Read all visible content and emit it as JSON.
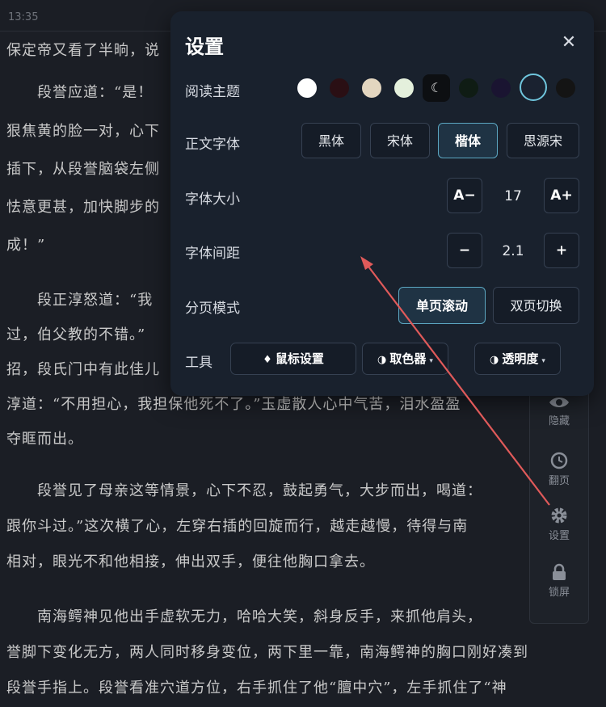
{
  "status_bar": {
    "time": "13:35"
  },
  "reader": {
    "lines": [
      "保定帝又看了半晌，说",
      "",
      "　　段誉应道：“是！",
      "狠焦黄的脸一对，心下",
      "插下，从段誉脑袋左侧",
      "怯意更甚，加快脚步的",
      "成！”",
      "",
      "　　段正淳怒道：“我",
      "过，伯父教的不错。”",
      "招，段氏门中有此佳儿",
      "淳道：“不用担心，我担保他死不了。”玉虚散人心中气苦，泪水盈盈",
      "夺眶而出。",
      "",
      "　　段誉见了母亲这等情景，心下不忍，鼓起勇气，大步而出，喝道：",
      "跟你斗过。”这次横了心，左穿右插的回旋而行，越走越慢，待得与南",
      "相对，眼光不和他相接，伸出双手，便往他胸口拿去。",
      "",
      "　　南海鳄神见他出手虚软无力，哈哈大笑，斜身反手，来抓他肩头，",
      "誉脚下变化无方，两人同时移身变位，两下里一靠，南海鳄神的胸口刚好凑到",
      "段誉手指上。段誉看准穴道方位，右手抓住了他“膻中穴”，左手抓住了“神"
    ]
  },
  "toolbar": {
    "items": [
      {
        "label": "隐藏",
        "icon": "eye-icon"
      },
      {
        "label": "翻页",
        "icon": "clock-icon"
      },
      {
        "label": "设置",
        "icon": "gear-icon"
      },
      {
        "label": "锁屏",
        "icon": "lock-icon"
      }
    ]
  },
  "settings": {
    "title": "设置",
    "close": "✕",
    "theme": {
      "label": "阅读主题",
      "colors": [
        "#ffffff",
        "#2a0f14",
        "#e3d6c0",
        "#e4f0dc",
        "#0d0f12",
        "#0f1c14",
        "#1a1431",
        "#1a2230",
        "#141414"
      ],
      "moon": "☾",
      "selected_index": 7
    },
    "font": {
      "label": "正文字体",
      "options": [
        "黑体",
        "宋体",
        "楷体",
        "思源宋"
      ],
      "selected": "楷体"
    },
    "size": {
      "label": "字体大小",
      "decrease": "A−",
      "value": "17",
      "increase": "A+"
    },
    "spacing": {
      "label": "字体间距",
      "decrease": "−",
      "value": "2.1",
      "increase": "+"
    },
    "paging": {
      "label": "分页模式",
      "options": [
        "单页滚动",
        "双页切换"
      ],
      "selected": "单页滚动"
    },
    "tools": {
      "label": "工具",
      "mouse": "鼠标设置",
      "picker": "取色器",
      "opacity": "透明度"
    }
  },
  "colors": {
    "accent": "#5ca7c2",
    "arrow": "#e05a5a",
    "panel_bg": "#19212d"
  }
}
